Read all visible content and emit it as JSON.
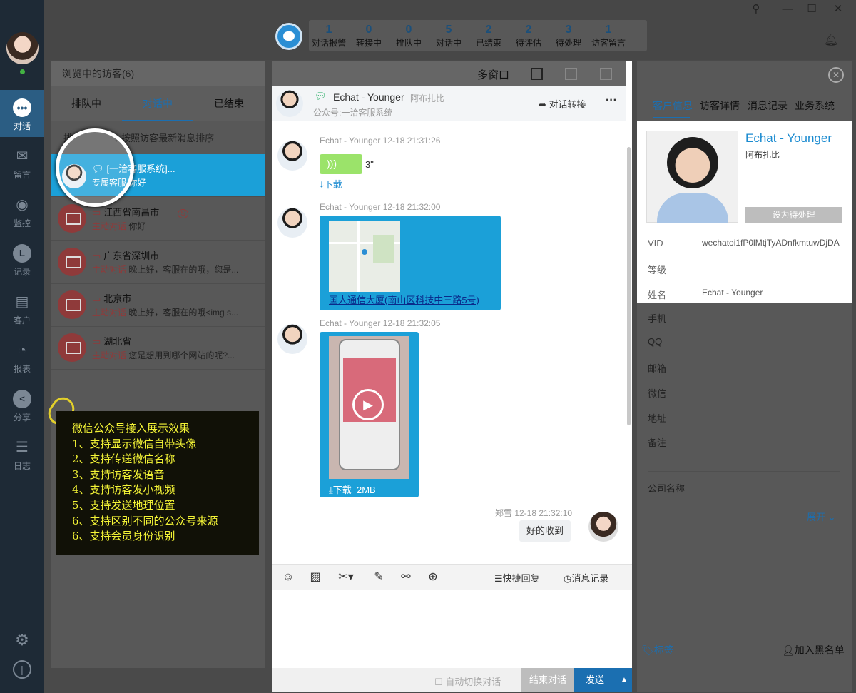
{
  "nav": {
    "items": [
      {
        "label": "对话",
        "icon": "chat-icon"
      },
      {
        "label": "留言",
        "icon": "mail-icon"
      },
      {
        "label": "监控",
        "icon": "eye-icon"
      },
      {
        "label": "记录",
        "icon": "clock-icon"
      },
      {
        "label": "客户",
        "icon": "contact-card-icon"
      },
      {
        "label": "报表",
        "icon": "pie-chart-icon"
      },
      {
        "label": "分享",
        "icon": "share-icon"
      },
      {
        "label": "日志",
        "icon": "clipboard-icon"
      }
    ]
  },
  "stats": [
    {
      "n": "1",
      "l": "对话报警"
    },
    {
      "n": "0",
      "l": "转接中"
    },
    {
      "n": "0",
      "l": "排队中"
    },
    {
      "n": "5",
      "l": "对话中"
    },
    {
      "n": "2",
      "l": "已结束"
    },
    {
      "n": "2",
      "l": "待评估"
    },
    {
      "n": "3",
      "l": "待处理"
    },
    {
      "n": "1",
      "l": "访客留言"
    }
  ],
  "visitors": {
    "title": "浏览中的访客(6)",
    "tabs": [
      "排队中",
      "对话中",
      "已结束"
    ],
    "sort_prefix": "排",
    "sort_label": "按照访客最新消息排序",
    "rows": [
      {
        "title": "[一洽客服系统]...",
        "tag": "专属客服",
        "msg": "你好"
      },
      {
        "title": "江西省南昌市",
        "tag": "主动对话",
        "msg": "你好"
      },
      {
        "title": "广东省深圳市",
        "tag": "主动对话",
        "msg": "晚上好，客服在的哦，您是..."
      },
      {
        "title": "北京市",
        "tag": "主动对话",
        "msg": "晚上好，客服在的哦<img s..."
      },
      {
        "title": "湖北省",
        "tag": "主动对话",
        "msg": "您是想用到哪个网站的呢?..."
      }
    ]
  },
  "note": {
    "lines": [
      "微信公众号接入展示效果",
      "1、支持显示微信自带头像",
      "2、支持传递微信名称",
      "3、支持访客发语音",
      "4、支持访客发小视频",
      "5、支持发送地理位置",
      "6、支持区别不同的公众号来源",
      "6、支持会员身份识别"
    ]
  },
  "chat": {
    "window_label": "多窗口",
    "name": "Echat - Younger",
    "nick": "阿布扎比",
    "source": "公众号:一洽客服系统",
    "transfer": "对话转接",
    "messages": [
      {
        "meta": "Echat - Younger 12-18 21:31:26",
        "duration": "3\"",
        "download": "下载"
      },
      {
        "meta": "Echat - Younger 12-18 21:32:00",
        "address": "国人通信大厦(南山区科技中三路5号)"
      },
      {
        "meta": "Echat - Younger 12-18 21:32:05",
        "download": "下载",
        "size": "2MB"
      },
      {
        "meta": "郑雪 12-18 21:32:10",
        "text": "好的收到"
      }
    ],
    "quick_reply": "快捷回复",
    "history": "消息记录",
    "auto_switch": "自动切换对话",
    "end": "结束对话",
    "send": "发送"
  },
  "info": {
    "tabs": [
      "客户信息",
      "访客详情",
      "消息记录",
      "业务系统"
    ],
    "name": "Echat - Younger",
    "nick": "阿布扎比",
    "pending_btn": "设为待处理",
    "fields": [
      {
        "k": "VID",
        "v": "wechatoi1fP0lMtjTyADnfkmtuwDjDA"
      },
      {
        "k": "等级",
        "v": ""
      },
      {
        "k": "姓名",
        "v": "Echat - Younger"
      },
      {
        "k": "手机",
        "v": ""
      },
      {
        "k": "QQ",
        "v": ""
      },
      {
        "k": "邮箱",
        "v": ""
      },
      {
        "k": "微信",
        "v": ""
      },
      {
        "k": "地址",
        "v": ""
      },
      {
        "k": "备注",
        "v": ""
      },
      {
        "k": "公司名称",
        "v": ""
      }
    ],
    "expand": "展开",
    "tag": "标签",
    "blacklist": "加入黑名单"
  }
}
